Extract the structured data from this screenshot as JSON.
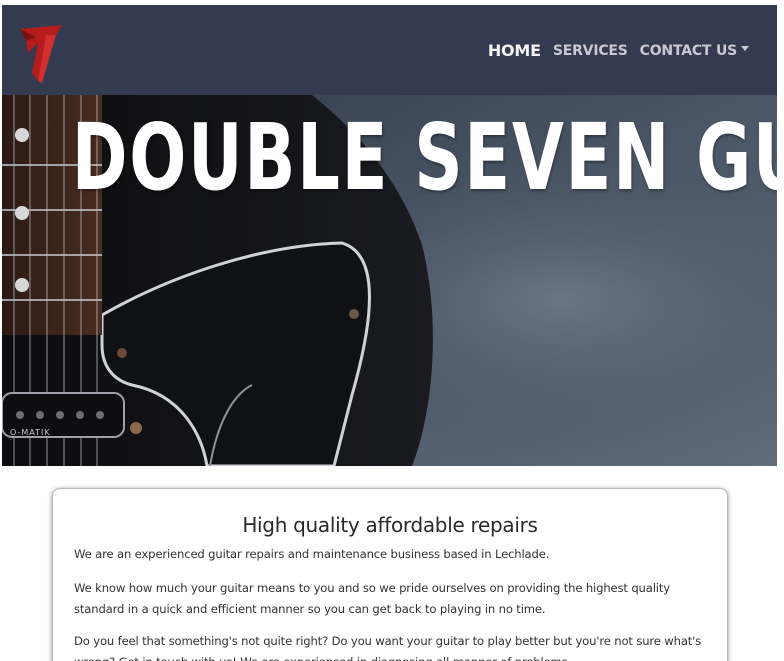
{
  "nav": {
    "logo_alt": "Double Seven Guitars logo",
    "items": [
      {
        "label": "HOME",
        "active": true
      },
      {
        "label": "SERVICES",
        "active": false
      },
      {
        "label": "CONTACT US",
        "active": false,
        "dropdown": true
      }
    ]
  },
  "hero": {
    "title": "DOUBLE SEVEN GUITARS",
    "pickup_text": "O-MATIK"
  },
  "main": {
    "heading": "High quality affordable repairs",
    "paragraphs": [
      "We are an experienced guitar repairs and maintenance business based in Lechlade.",
      "We know how much your guitar means to you and so we pride ourselves on providing the highest quality standard in a quick and efficient manner so you can get back to playing in no time.",
      "Do you feel that something's not quite right? Do you want your guitar to play better but you're not sure what's wrong? Get in touch with us! We are experienced in diagnosing all manner of problems."
    ]
  },
  "colors": {
    "navbar": "#343a4f",
    "logo_red": "#b71c1c",
    "text": "#333333"
  }
}
